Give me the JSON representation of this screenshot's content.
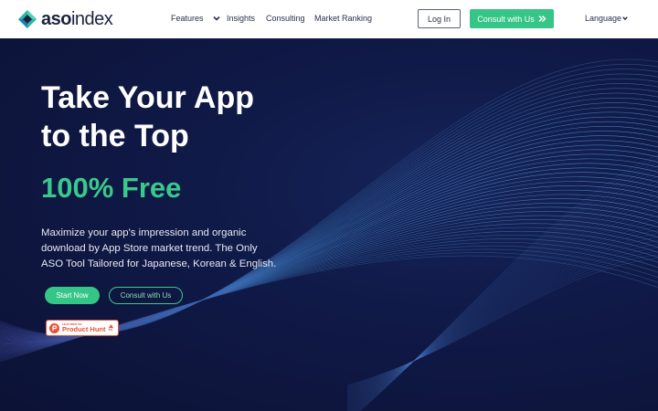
{
  "header": {
    "logo": {
      "brand_bold": "aso",
      "brand_regular": "index"
    },
    "nav": {
      "features": "Features",
      "insights": "Insights",
      "consulting": "Consulting",
      "market_ranking": "Market Ranking"
    },
    "login_label": "Log In",
    "consult_label": "Consult with Us",
    "language_label": "Language"
  },
  "hero": {
    "headline_line1": "Take Your App",
    "headline_line2": "to the Top",
    "free_label": "100% Free",
    "description": "Maximize your app's impression and organic download by App Store market trend. The Only ASO Tool Tailored for Japanese, Korean & English.",
    "start_label": "Start Now",
    "consult_label": "Consult with Us",
    "product_hunt": {
      "small_text": "FEATURED ON",
      "big_text": "Product Hunt",
      "count": "64"
    }
  },
  "colors": {
    "accent_green": "#35c586",
    "hero_bg": "#0e1438",
    "product_hunt_red": "#e8523a"
  },
  "icons": [
    "logo-diamond-icon",
    "chevron-down-icon",
    "double-chevron-right-icon",
    "product-hunt-icon",
    "upvote-arrow-icon"
  ]
}
